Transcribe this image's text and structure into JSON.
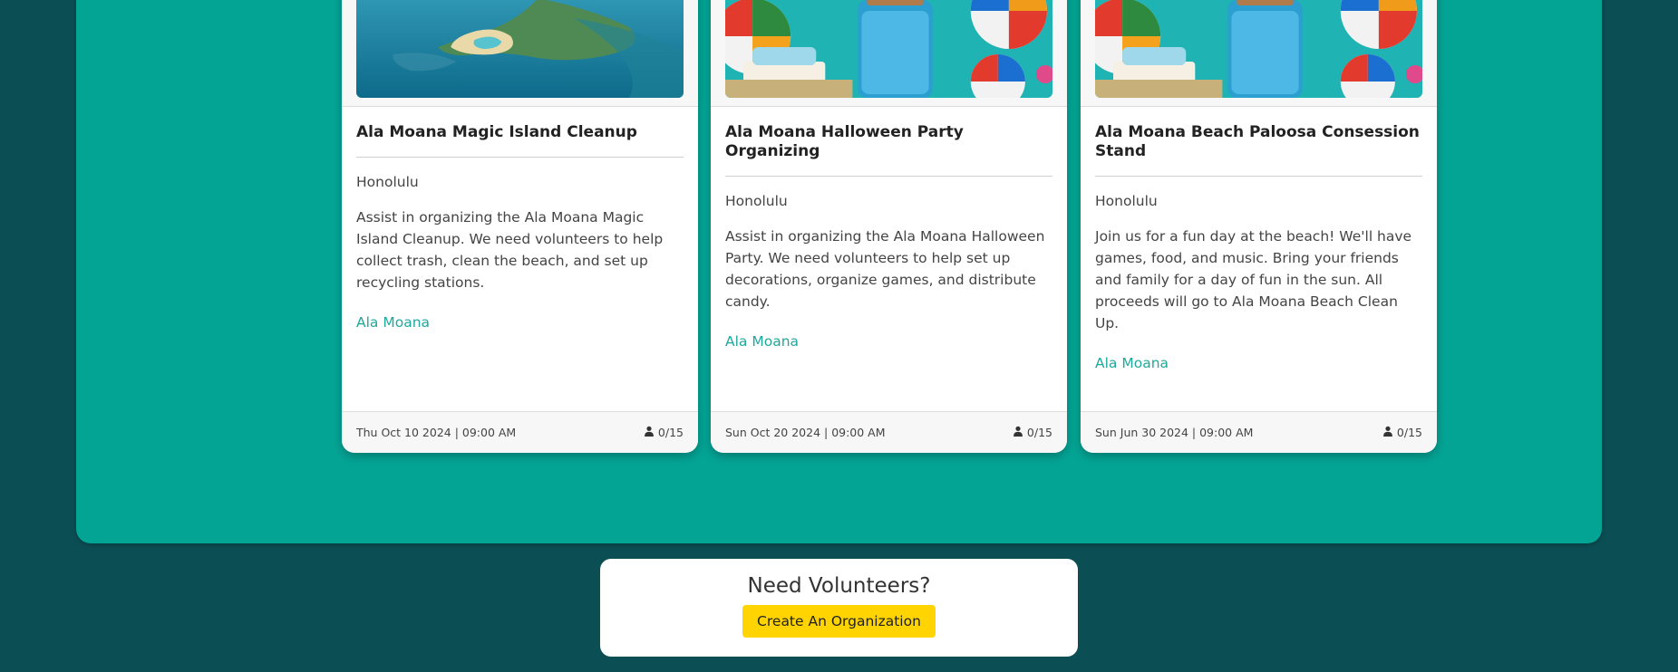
{
  "events": [
    {
      "title": "Ala Moana Magic Island Cleanup",
      "city": "Honolulu",
      "description": "Assist in organizing the Ala Moana Magic Island Cleanup. We need volunteers to help collect trash, clean the beach, and set up recycling stations.",
      "organization": "Ala Moana",
      "datetime": "Thu Oct 10 2024 | 09:00 AM",
      "capacity": "0/15",
      "image": "aerial-coastline-photo"
    },
    {
      "title": "Ala Moana Halloween Party Organizing",
      "city": "Honolulu",
      "description": "Assist in organizing the Ala Moana Halloween Party. We need volunteers to help set up decorations, organize games, and distribute candy.",
      "organization": "Ala Moana",
      "datetime": "Sun Oct 20 2024 | 09:00 AM",
      "capacity": "0/15",
      "image": "beach-party-photo"
    },
    {
      "title": "Ala Moana Beach Paloosa Consession Stand",
      "city": "Honolulu",
      "description": "Join us for a fun day at the beach! We'll have games, food, and music. Bring your friends and family for a day of fun in the sun. All proceeds will go to Ala Moana Beach Clean Up.",
      "organization": "Ala Moana",
      "datetime": "Sun Jun 30 2024 | 09:00 AM",
      "capacity": "0/15",
      "image": "beach-party-photo"
    }
  ],
  "cta": {
    "title": "Need Volunteers?",
    "button_label": "Create An Organization"
  },
  "colors": {
    "page_background": "#0b4f55",
    "panel_background": "#04a495",
    "link": "#1fa89c",
    "cta_button": "#ffd400"
  }
}
